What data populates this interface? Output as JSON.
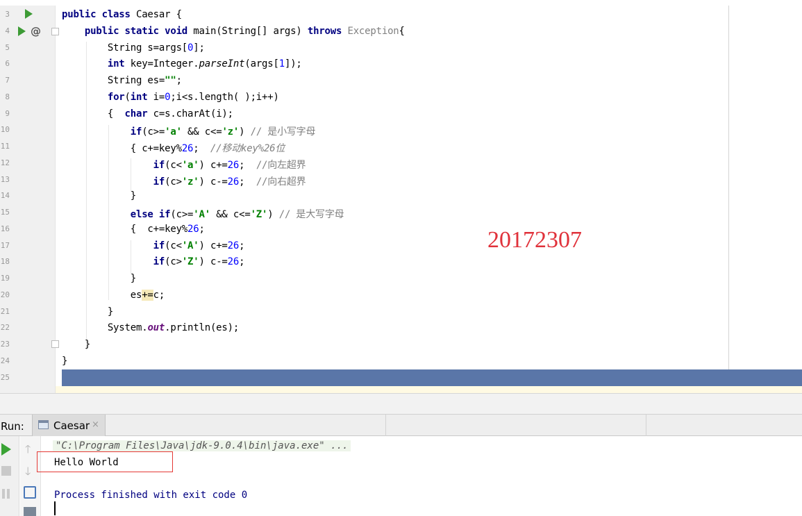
{
  "editor": {
    "lines": [
      {
        "num": "3",
        "html": "<span class='kw'>public class</span> Caesar {"
      },
      {
        "num": "4",
        "html": "    <span class='kw'>public static void</span> main(String[] args) <span class='kw'>throws</span> <span class='gray'>Exception</span>{"
      },
      {
        "num": "5",
        "html": "        String s=args[<span class='num'>0</span>];"
      },
      {
        "num": "6",
        "html": "        <span class='kw'>int</span> key=Integer.<span class='it'>parseInt</span>(args[<span class='num'>1</span>]);"
      },
      {
        "num": "7",
        "html": "        String es=<span class='str'>\"\"</span>;"
      },
      {
        "num": "8",
        "html": "        <span class='kw'>for</span>(<span class='kw'>int</span> i=<span class='num'>0</span>;i&lt;s.length( );i++)"
      },
      {
        "num": "9",
        "html": "        {  <span class='kw'>char</span> c=s.charAt(i);"
      },
      {
        "num": "10",
        "html": "            <span class='kw'>if</span>(c&gt;=<span class='str'>'a'</span> &amp;&amp; c&lt;=<span class='str'>'z'</span>) <span class='cm'>// 是小写字母</span>"
      },
      {
        "num": "11",
        "html": "            { c+=key%<span class='num'>26</span>;  <span class='cmi'>//移动key%26位</span>"
      },
      {
        "num": "12",
        "html": "                <span class='kw'>if</span>(c&lt;<span class='str'>'a'</span>) c+=<span class='num'>26</span>;  <span class='cm'>//向左超界</span>"
      },
      {
        "num": "13",
        "html": "                <span class='kw'>if</span>(c&gt;<span class='str'>'z'</span>) c-=<span class='num'>26</span>;  <span class='cm'>//向右超界</span>"
      },
      {
        "num": "14",
        "html": "            }"
      },
      {
        "num": "15",
        "html": "            <span class='kw'>else if</span>(c&gt;=<span class='str'>'A'</span> &amp;&amp; c&lt;=<span class='str'>'Z'</span>) <span class='cm'>// 是大写字母</span>"
      },
      {
        "num": "16",
        "html": "            {  c+=key%<span class='num'>26</span>;"
      },
      {
        "num": "17",
        "html": "                <span class='kw'>if</span>(c&lt;<span class='str'>'A'</span>) c+=<span class='num'>26</span>;"
      },
      {
        "num": "18",
        "html": "                <span class='kw'>if</span>(c&gt;<span class='str'>'Z'</span>) c-=<span class='num'>26</span>;"
      },
      {
        "num": "19",
        "html": "            }"
      },
      {
        "num": "20",
        "html": "            es<span class='hl'>+=</span>c;"
      },
      {
        "num": "21",
        "html": "        }"
      },
      {
        "num": "22",
        "html": "        System.<span class='fld'>out</span>.println(es);"
      },
      {
        "num": "23",
        "html": "    }"
      },
      {
        "num": "24",
        "html": "}"
      },
      {
        "num": "25",
        "html": ""
      }
    ]
  },
  "annotation": {
    "student_id": "20172307"
  },
  "run_panel": {
    "label": "Run:",
    "tab_label": "Caesar",
    "tab_close": "×",
    "up_arrow": "🡑",
    "down_arrow": "🡓"
  },
  "console": {
    "command": "\"C:\\Program Files\\Java\\jdk-9.0.4\\bin\\java.exe\" ...",
    "output": "Hello World",
    "exit": "Process finished with exit code 0"
  },
  "colors": {
    "keyword": "#000080",
    "number": "#0000ff",
    "string": "#008000",
    "comment": "#808080",
    "selection": "#5a76a8",
    "annotation_red": "#e0313a",
    "run_green": "#3d9b35"
  }
}
